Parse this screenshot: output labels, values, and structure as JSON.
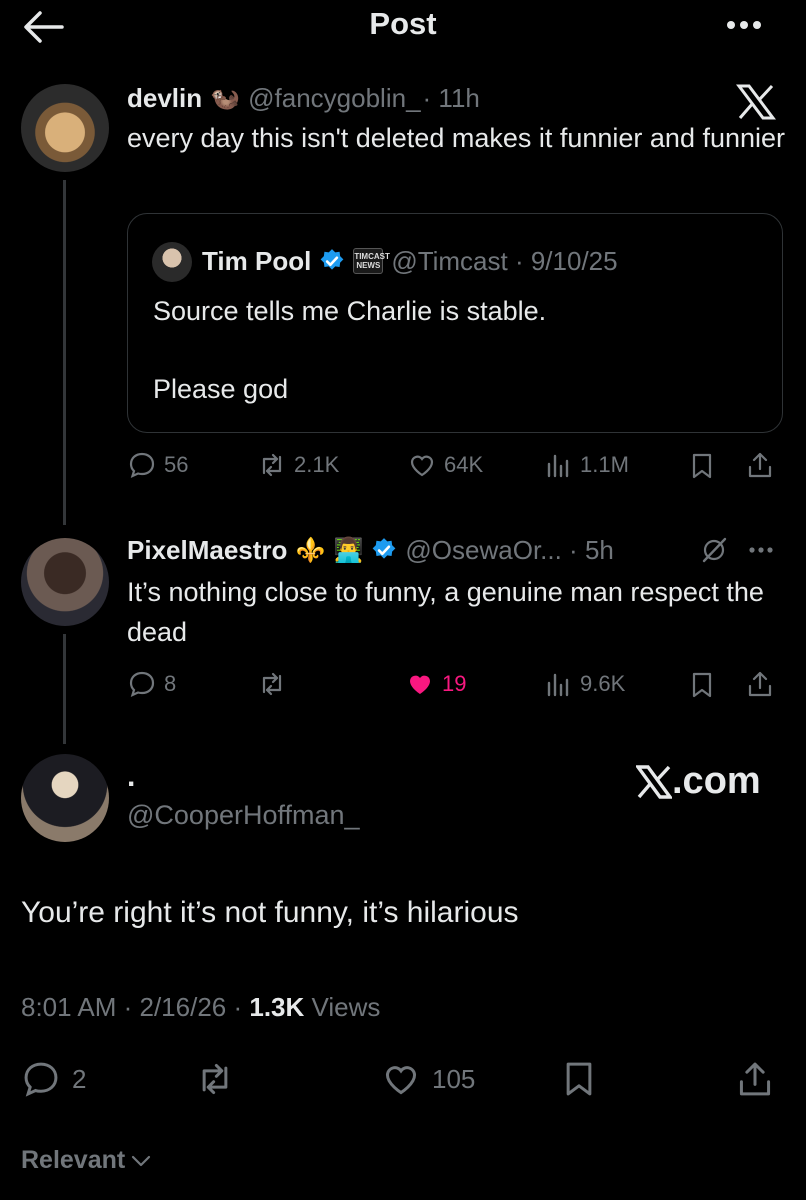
{
  "header": {
    "title": "Post"
  },
  "reply1": {
    "name": "devlin",
    "emoji": "🦦",
    "handle": "@fancygoblin_",
    "time": "· 11h",
    "text": "every day this isn't deleted makes it funnier and funnier",
    "quote": {
      "name": "Tim Pool",
      "badge_line1": "TIMCAST",
      "badge_line2": "NEWS",
      "handle_time": "@Timcast · 9/10/25",
      "text_line1": "Source tells me Charlie is stable.",
      "text_line2": "Please god"
    },
    "stats": {
      "replies": "56",
      "reposts": "2.1K",
      "likes": "64K",
      "views": "1.1M"
    }
  },
  "reply2": {
    "name": "PixelMaestro",
    "emoji1": "⚜️",
    "emoji2": "👨‍💻",
    "handle_time": "@OsewaOr... · 5h",
    "text": "It’s nothing close to funny, a genuine man respect the dead",
    "stats": {
      "replies": "8",
      "reposts": "",
      "likes": "19",
      "views": "9.6K"
    }
  },
  "main": {
    "name": ".",
    "handle": "@CooperHoffman_",
    "brand": ".com",
    "text": "You’re right it’s not funny, it’s hilarious",
    "time": "8:01 AM · 2/16/26 · ",
    "views_count": "1.3K",
    "views_label": " Views",
    "stats": {
      "replies": "2",
      "likes": "105"
    }
  },
  "footer": {
    "sort_label": "Relevant"
  },
  "colors": {
    "background": "#000000",
    "text": "#e7e9ea",
    "muted": "#71767b",
    "like_active": "#f91880",
    "verified": "#1d9bf0"
  },
  "icons": [
    "back-arrow-icon",
    "more-icon",
    "x-logo-icon",
    "verified-icon",
    "reply-icon",
    "repost-icon",
    "like-icon",
    "views-icon",
    "bookmark-icon",
    "share-icon",
    "grok-icon",
    "chevron-down-icon"
  ]
}
